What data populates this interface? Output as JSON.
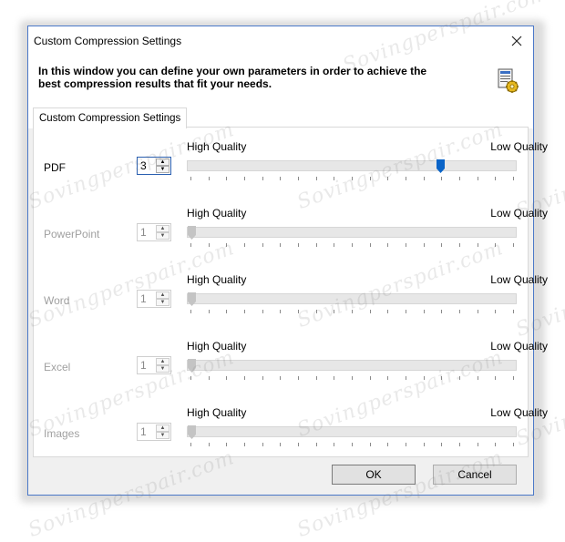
{
  "window": {
    "title": "Custom Compression Settings",
    "header_text": "In this window you can define your own parameters in order to achieve the best compression results that fit your needs.",
    "header_icon": "compression-settings-icon",
    "close_icon": "close-icon"
  },
  "tab": {
    "label": "Custom Compression Settings"
  },
  "scale": {
    "high_label": "High Quality",
    "low_label": "Low Quality"
  },
  "rows": [
    {
      "label": "PDF",
      "value": "3",
      "enabled": true,
      "level_fraction": 0.78
    },
    {
      "label": "PowerPoint",
      "value": "1",
      "enabled": false,
      "level_fraction": 0.0
    },
    {
      "label": "Word",
      "value": "1",
      "enabled": false,
      "level_fraction": 0.0
    },
    {
      "label": "Excel",
      "value": "1",
      "enabled": false,
      "level_fraction": 0.0
    },
    {
      "label": "Images",
      "value": "1",
      "enabled": false,
      "level_fraction": 0.0
    }
  ],
  "buttons": {
    "ok": "OK",
    "cancel": "Cancel"
  },
  "watermark": "Sovingperspair.com",
  "colors": {
    "accent": "#0a64c8",
    "window_border": "#4a78c8"
  }
}
